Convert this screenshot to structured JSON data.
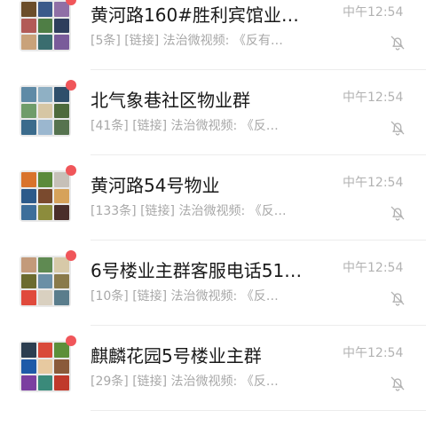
{
  "chats": [
    {
      "title": "黄河路160#胜利宾馆业…",
      "preview": "[5条] [链接] 法治微视频: 《反有…",
      "time": "中午12:54",
      "unread_dot": true,
      "muted": true,
      "tile_colors": [
        "#6b4d2a",
        "#3b5a8a",
        "#8f6fa6",
        "#b25b57",
        "#4f7e45",
        "#2e3e5c",
        "#c9a27a",
        "#3a6d6f",
        "#7a5b9a"
      ]
    },
    {
      "title": "北气象巷社区物业群",
      "preview": "[41条] [链接] 法治微视频: 《反…",
      "time": "中午12:54",
      "unread_dot": true,
      "muted": true,
      "tile_colors": [
        "#5f8aa6",
        "#8fb0c4",
        "#2f4f6b",
        "#6f9c6a",
        "#d6c6a4",
        "#4d6a3c",
        "#3b6b8c",
        "#9bb7cf",
        "#56734f"
      ]
    },
    {
      "title": "黄河路54号物业",
      "preview": "[133条] [链接] 法治微视频: 《反…",
      "time": "中午12:54",
      "unread_dot": true,
      "muted": true,
      "tile_colors": [
        "#d9732c",
        "#5b8a3a",
        "#c6c0b8",
        "#2c5a8a",
        "#7a4a2e",
        "#d6a25a",
        "#3d6e9a",
        "#8c8c3c",
        "#4a2e2a"
      ]
    },
    {
      "title": "6号楼业主群客服电话51…",
      "preview": "[10条] [链接] 法治微视频: 《反…",
      "time": "中午12:54",
      "unread_dot": true,
      "muted": true,
      "tile_colors": [
        "#c39a7a",
        "#5f8a52",
        "#d7c9a8",
        "#6b6b2f",
        "#6a8fa6",
        "#8a7a4a",
        "#e04a3c",
        "#d9d0c0",
        "#5a7d8c"
      ]
    },
    {
      "title": "麒麟花园5号楼业主群",
      "preview": "[29条] [链接] 法治微视频: 《反…",
      "time": "中午12:54",
      "unread_dot": true,
      "muted": true,
      "tile_colors": [
        "#2c3e50",
        "#d94a3a",
        "#5c8f3a",
        "#1e5aa8",
        "#e7c9a0",
        "#8a5a3a",
        "#7b3fa0",
        "#3a8a7a",
        "#c0392b"
      ]
    }
  ],
  "icons": {
    "mute": "bell-off-icon"
  },
  "colors": {
    "unread_dot": "#f0565a",
    "title": "#191919",
    "secondary": "#a8a8a8"
  }
}
